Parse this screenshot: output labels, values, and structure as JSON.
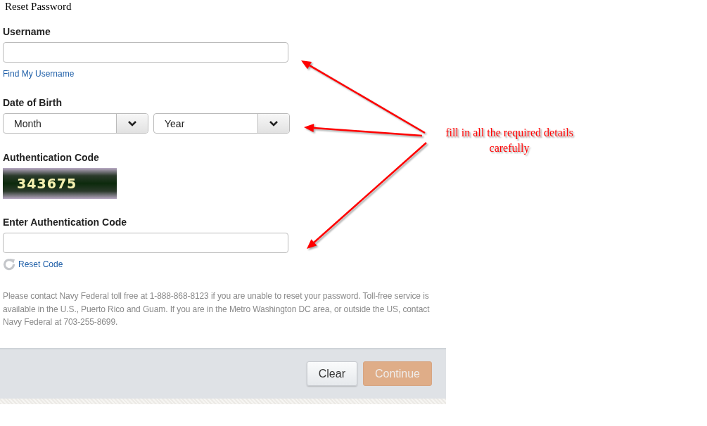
{
  "window": {
    "title": "Reset Password"
  },
  "username": {
    "label": "Username",
    "link": "Find My Username"
  },
  "date_of_birth": {
    "label": "Date of Birth",
    "selects": [
      {
        "value": "Month"
      },
      {
        "value": "Year"
      }
    ]
  },
  "authentication_code": {
    "label": "Authentication Code",
    "code": "343675"
  },
  "enter_code": {
    "label": "Enter Authentication Code",
    "reset_link": "Reset Code"
  },
  "help_text": "Please contact Navy Federal toll free at 1-888-868-8123 if you are unable to reset your password. Toll-free service is available in the U.S., Puerto Rico and Guam. If you are in the Metro Washington DC area, or outside the US, contact Navy Federal at 703-255-8699.",
  "buttons": [
    {
      "label": "Clear",
      "kind": "secondary",
      "disabled": false
    },
    {
      "label": "Continue",
      "kind": "primary",
      "disabled": true
    }
  ],
  "annotation": {
    "text": "fill in all the required details carefully"
  }
}
